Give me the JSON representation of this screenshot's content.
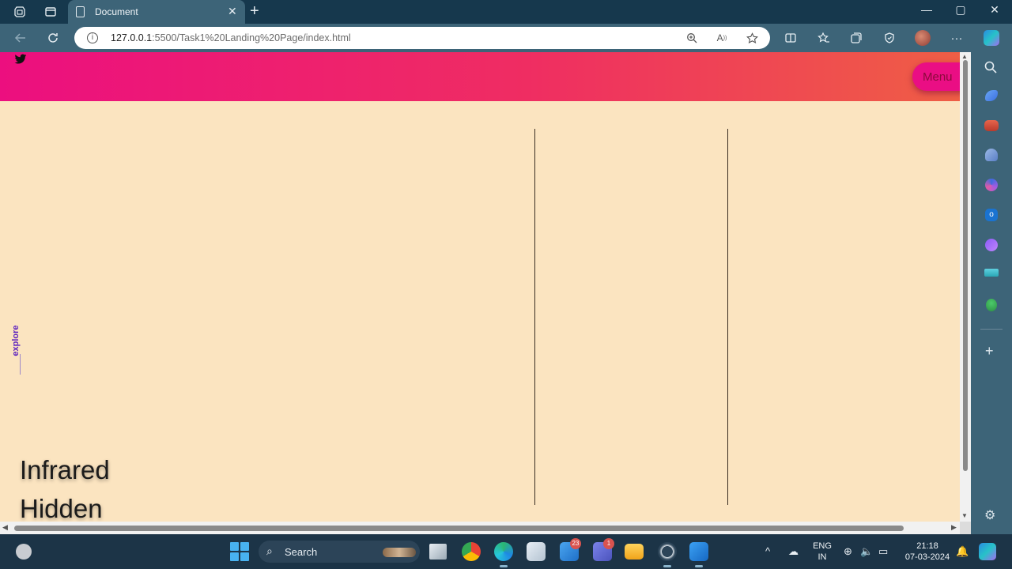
{
  "browser": {
    "tab": {
      "title": "Document",
      "close": "✕"
    },
    "new_tab": "+",
    "window": {
      "minimize": "—",
      "maximize": "▢",
      "close": "✕"
    },
    "address": {
      "host": "127.0.0.1",
      "path": ":5500/Task1%20Landing%20Page/index.html"
    }
  },
  "page": {
    "menu_label": "Menu",
    "explore_label": "explore",
    "heading_line1": "Infrared",
    "heading_line2": "Hidden",
    "colors": {
      "background": "#fbe4c0",
      "gradient_start": "#ec0f7f",
      "gradient_end": "#ef5e45",
      "menu": "#ea0e84",
      "explore": "#5a1fbf"
    }
  },
  "taskbar": {
    "search_label": "Search",
    "mail_badge": "23",
    "teams_badge": "1",
    "language_line1": "ENG",
    "language_line2": "IN",
    "time": "21:18",
    "date": "07-03-2024"
  }
}
